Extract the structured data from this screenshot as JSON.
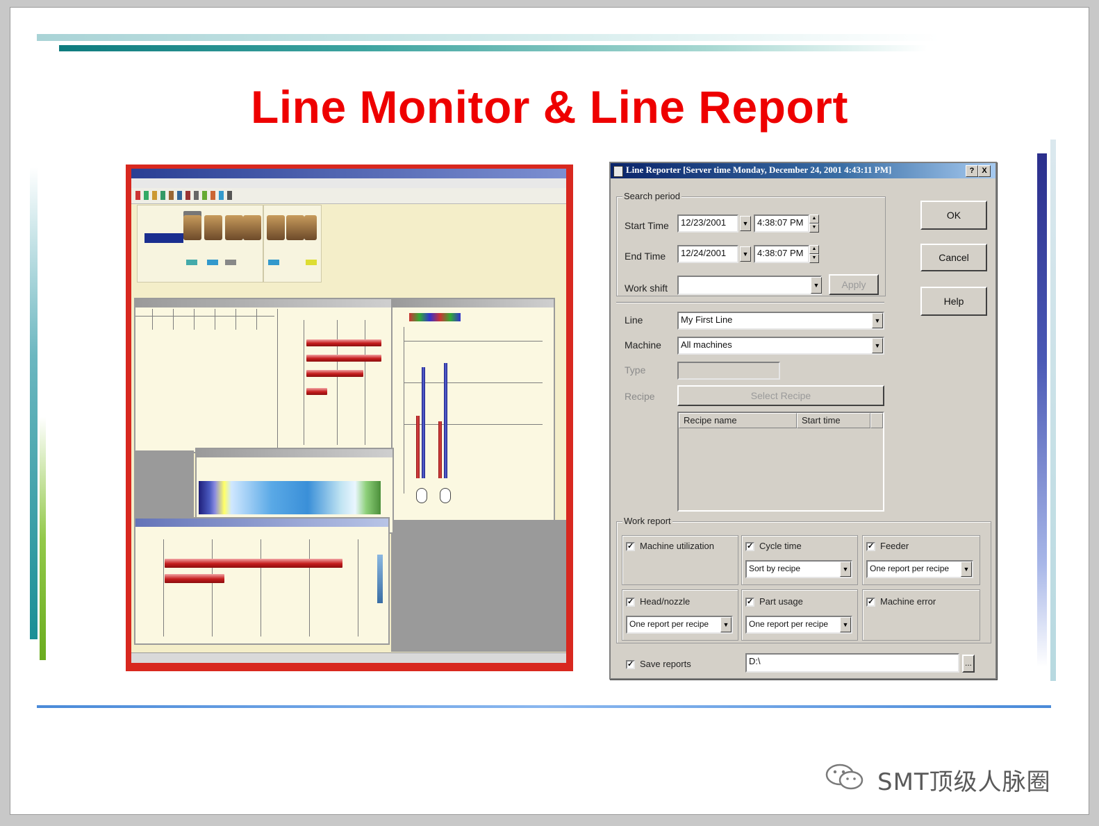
{
  "slide": {
    "title": "Line Monitor & Line Report"
  },
  "dialog": {
    "title": "Line Reporter [Server time Monday, December 24, 2001 4:43:11 PM]",
    "title_buttons": [
      "?",
      "X"
    ],
    "search_period_label": "Search period",
    "start_time_label": "Start Time",
    "start_date": "12/23/2001",
    "start_time": "4:38:07 PM",
    "end_time_label": "End Time",
    "end_date": "12/24/2001",
    "end_time": "4:38:07 PM",
    "work_shift_label": "Work shift",
    "work_shift_value": "",
    "apply_label": "Apply",
    "ok_label": "OK",
    "cancel_label": "Cancel",
    "help_label": "Help",
    "line_label": "Line",
    "line_value": "My First Line",
    "machine_label": "Machine",
    "machine_value": "All machines",
    "type_label": "Type",
    "recipe_label": "Recipe",
    "select_recipe_label": "Select Recipe",
    "recipe_columns": [
      "Recipe name",
      "Start time"
    ],
    "work_report_label": "Work report",
    "machine_utilization_label": "Machine utilization",
    "cycle_time_label": "Cycle time",
    "cycle_time_option": "Sort by recipe",
    "feeder_label": "Feeder",
    "feeder_option": "One report per recipe",
    "head_nozzle_label": "Head/nozzle",
    "head_nozzle_option": "One report per recipe",
    "part_usage_label": "Part usage",
    "part_usage_option": "One report per recipe",
    "machine_error_label": "Machine error",
    "save_reports_label": "Save reports",
    "save_path": "D:\\",
    "browse_label": "..."
  },
  "watermark": {
    "text": "SMT顶级人脉圈"
  },
  "colors": {
    "title_red": "#ee0000",
    "monitor_frame_red": "#d8281f",
    "dialog_gray": "#d4d0c8",
    "titlebar_blue": "#0a246a"
  },
  "icons": {
    "dialog_icon": "line-reporter-icon",
    "dropdown": "chevron-down-icon",
    "spin": "spin-updown-icon",
    "watermark": "wechat-icon"
  }
}
